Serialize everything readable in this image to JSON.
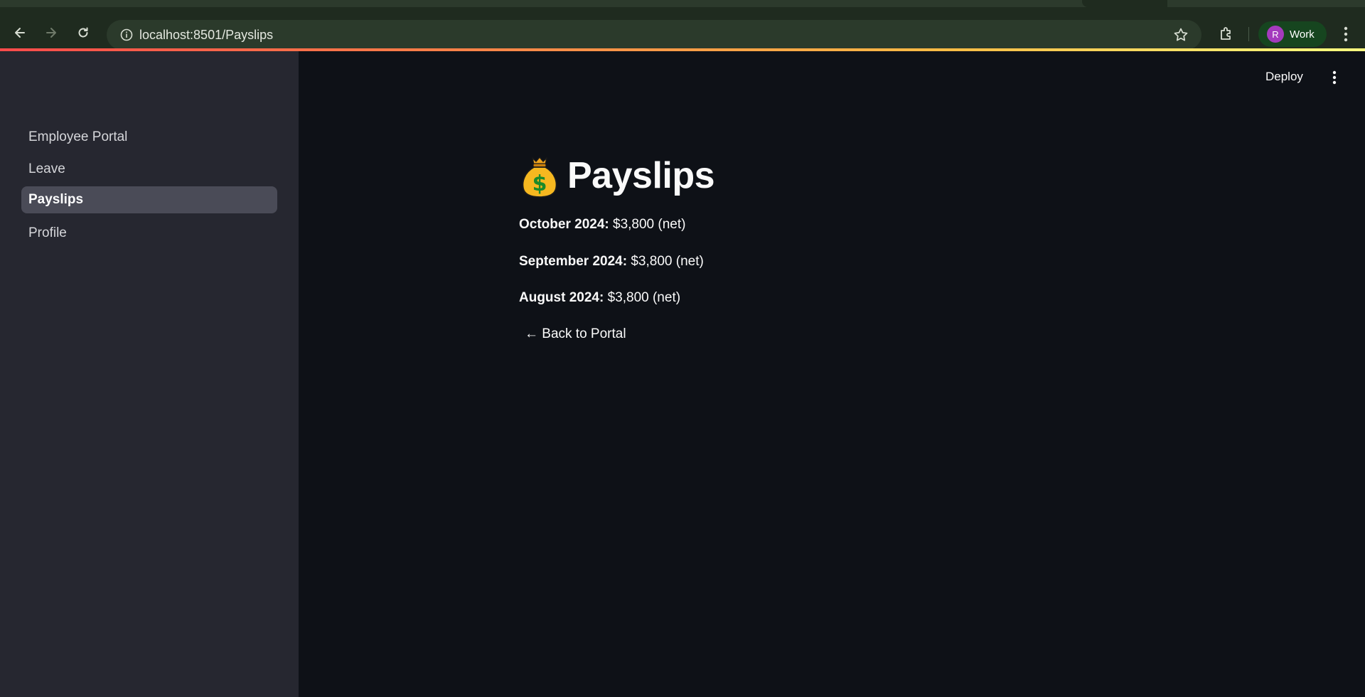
{
  "browser": {
    "url": "localhost:8501/Payslips",
    "profile_initial": "R",
    "profile_name": "Work"
  },
  "sidebar": {
    "items": [
      {
        "label": "Employee Portal",
        "active": false
      },
      {
        "label": "Leave",
        "active": false
      },
      {
        "label": "Payslips",
        "active": true
      },
      {
        "label": "Profile",
        "active": false
      }
    ]
  },
  "header": {
    "deploy_label": "Deploy"
  },
  "main": {
    "title": "Payslips",
    "title_icon": "money-bag-icon",
    "payslips": [
      {
        "month": "October 2024:",
        "amount": " $3,800 (net)"
      },
      {
        "month": "September 2024:",
        "amount": " $3,800 (net)"
      },
      {
        "month": "August 2024:",
        "amount": " $3,800 (net)"
      }
    ],
    "back_label": "← Back to Portal"
  },
  "colors": {
    "app_background": "#0e1117",
    "sidebar_background": "#262730",
    "active_item_background": "#4a4b57",
    "accent_gradient_start": "#ff4b4b",
    "accent_gradient_end": "#fffd80",
    "browser_toolbar": "#1f2b1f"
  }
}
